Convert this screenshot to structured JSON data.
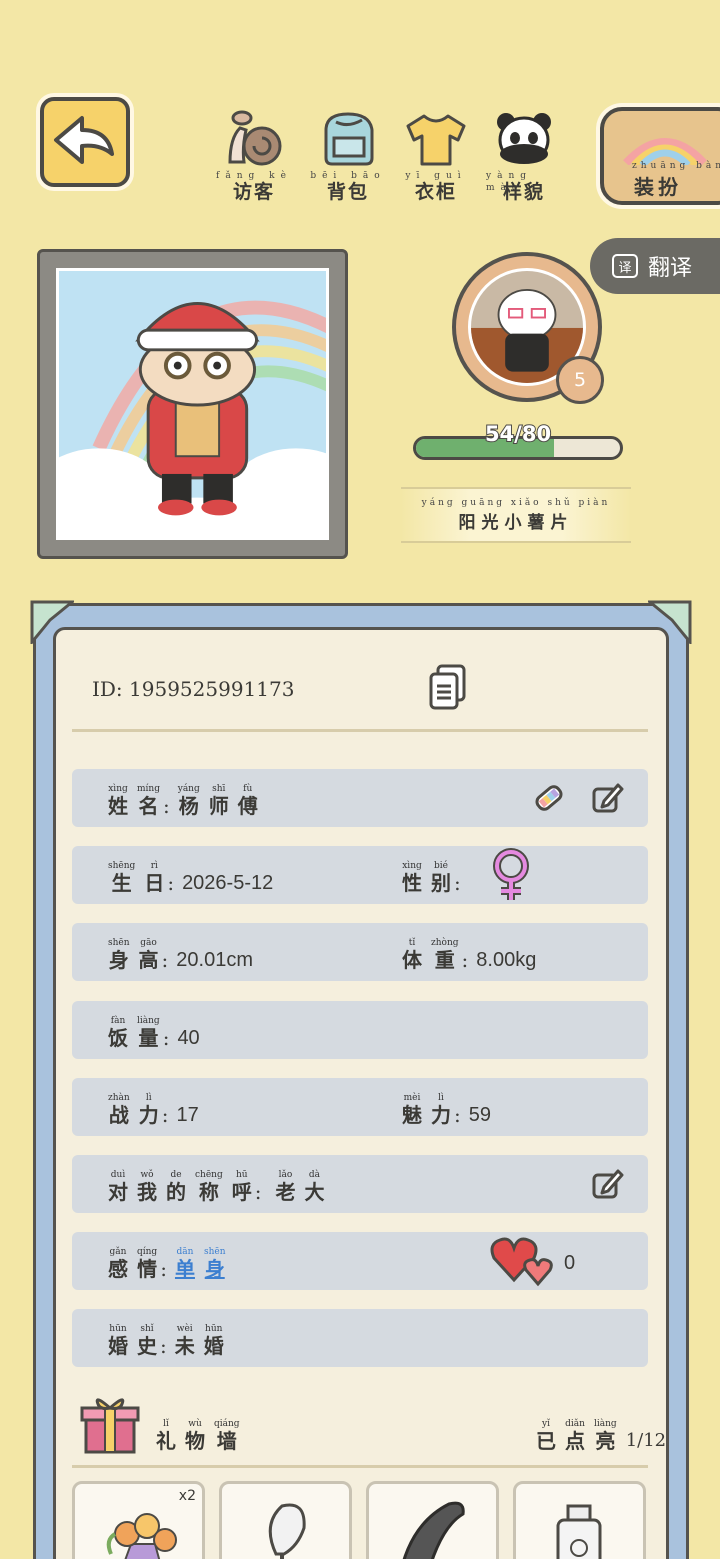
{
  "nav": {
    "visitors": {
      "py": "fǎng kè",
      "label": "访客"
    },
    "backpack": {
      "py": "bēi bāo",
      "label": "背包"
    },
    "wardrobe": {
      "py": "yī guì",
      "label": "衣柜"
    },
    "appearance": {
      "py": "yàng mào",
      "label": "样貌"
    },
    "dress_up": {
      "py": "zhuāng bàn",
      "label": "装扮"
    }
  },
  "translate": {
    "icon": "译",
    "label": "翻译"
  },
  "pet": {
    "level": "5",
    "xp_text": "54/80",
    "xp_fraction": 0.675,
    "title_py": "yáng guāng xiǎo shǔ piàn",
    "title": "阳光小薯片"
  },
  "profile": {
    "id_text": "ID: 1959525991173",
    "name_label": [
      {
        "py": "xìng",
        "c": "姓"
      },
      {
        "py": "míng",
        "c": "名"
      }
    ],
    "name_value": [
      {
        "py": "yáng",
        "c": "杨"
      },
      {
        "py": "shī",
        "c": "师"
      },
      {
        "py": "fù",
        "c": "傅"
      }
    ],
    "birthday_label": [
      {
        "py": "shēng",
        "c": "生"
      },
      {
        "py": "rì",
        "c": "日"
      }
    ],
    "birthday": "2026-5-12",
    "gender_label": [
      {
        "py": "xìng",
        "c": "性"
      },
      {
        "py": "bié",
        "c": "别"
      }
    ],
    "gender": "female",
    "height_label": [
      {
        "py": "shēn",
        "c": "身"
      },
      {
        "py": "gāo",
        "c": "高"
      }
    ],
    "height": "20.01cm",
    "weight_label": [
      {
        "py": "tǐ",
        "c": "体"
      },
      {
        "py": "zhòng",
        "c": "重"
      }
    ],
    "weight": "8.00kg",
    "appetite_label": [
      {
        "py": "fàn",
        "c": "饭"
      },
      {
        "py": "liàng",
        "c": "量"
      }
    ],
    "appetite": "40",
    "combat_label": [
      {
        "py": "zhàn",
        "c": "战"
      },
      {
        "py": "lì",
        "c": "力"
      }
    ],
    "combat": "17",
    "charm_label": [
      {
        "py": "mèi",
        "c": "魅"
      },
      {
        "py": "lì",
        "c": "力"
      }
    ],
    "charm": "59",
    "nickname_label": [
      {
        "py": "duì",
        "c": "对"
      },
      {
        "py": "wǒ",
        "c": "我"
      },
      {
        "py": "de",
        "c": "的"
      },
      {
        "py": "chēng",
        "c": "称"
      },
      {
        "py": "hū",
        "c": "呼"
      }
    ],
    "nickname": [
      {
        "py": "lǎo",
        "c": "老"
      },
      {
        "py": "dà",
        "c": "大"
      }
    ],
    "relationship_label": [
      {
        "py": "gǎn",
        "c": "感"
      },
      {
        "py": "qíng",
        "c": "情"
      }
    ],
    "relationship": [
      {
        "py": "dān",
        "c": "单"
      },
      {
        "py": "shēn",
        "c": "身"
      }
    ],
    "hearts": "0",
    "marriage_label": [
      {
        "py": "hūn",
        "c": "婚"
      },
      {
        "py": "shǐ",
        "c": "史"
      }
    ],
    "marriage": [
      {
        "py": "wèi",
        "c": "未"
      },
      {
        "py": "hūn",
        "c": "婚"
      }
    ]
  },
  "gifts": {
    "title": [
      {
        "py": "lǐ",
        "c": "礼"
      },
      {
        "py": "wù",
        "c": "物"
      },
      {
        "py": "qiáng",
        "c": "墙"
      }
    ],
    "lit_label": [
      {
        "py": "yǐ",
        "c": "已"
      },
      {
        "py": "diǎn",
        "c": "点"
      },
      {
        "py": "liàng",
        "c": "亮"
      }
    ],
    "lit_count": "1/12",
    "items": [
      {
        "icon": "bouquet-icon",
        "qty": "x2"
      },
      {
        "icon": "calla-lily-icon",
        "qty": ""
      },
      {
        "icon": "scarf-icon",
        "qty": ""
      },
      {
        "icon": "perfume-icon",
        "qty": ""
      }
    ]
  },
  "colors": {
    "background": "#f3e7a6",
    "card_frame": "#a9c2dd",
    "row": "#d5dae0",
    "link": "#3c7fd0",
    "xp_fill": "#6fb06e"
  }
}
